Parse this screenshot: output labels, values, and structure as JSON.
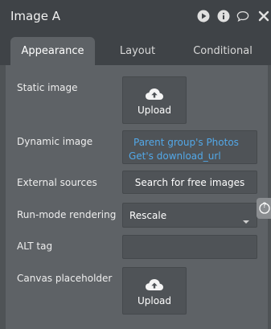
{
  "window": {
    "title": "Image A",
    "icons": [
      "play-icon",
      "info-icon",
      "comment-icon",
      "close-icon"
    ]
  },
  "tabs": [
    {
      "label": "Appearance",
      "active": true
    },
    {
      "label": "Layout",
      "active": false
    },
    {
      "label": "Conditional",
      "active": false
    }
  ],
  "fields": {
    "static_image": {
      "label": "Static image",
      "button": "Upload"
    },
    "dynamic_image": {
      "label": "Dynamic image",
      "line1": "Parent group's Photos",
      "line2": "Get's download_url"
    },
    "external_sources": {
      "label": "External sources",
      "button": "Search for free images"
    },
    "run_mode": {
      "label": "Run-mode rendering",
      "value": "Rescale"
    },
    "alt_tag": {
      "label": "ALT tag",
      "value": ""
    },
    "canvas_placeholder": {
      "label": "Canvas placeholder",
      "button": "Upload"
    }
  },
  "help_tab": {
    "label": "?"
  },
  "colors": {
    "link": "#52a8e8",
    "panel": "#5e6266",
    "header": "#3f4347"
  }
}
